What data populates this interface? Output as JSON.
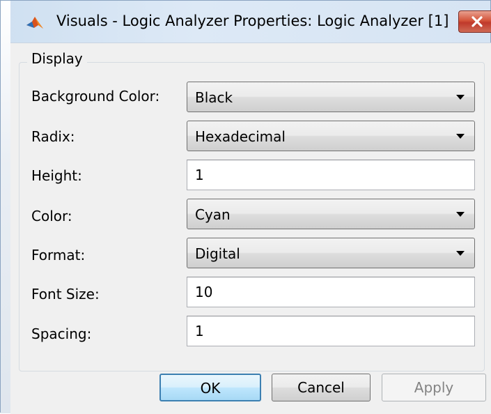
{
  "window": {
    "title": "Visuals - Logic Analyzer Properties: Logic Analyzer [1]",
    "app_icon": "matlab-icon",
    "close_icon": "close-icon",
    "close_color": "#c7402d"
  },
  "display_group": {
    "label": "Display",
    "fields": {
      "background_color": {
        "label": "Background Color:",
        "value": "Black"
      },
      "radix": {
        "label": "Radix:",
        "value": "Hexadecimal"
      },
      "height": {
        "label": "Height:",
        "value": "1"
      },
      "color": {
        "label": "Color:",
        "value": "Cyan"
      },
      "format": {
        "label": "Format:",
        "value": "Digital"
      },
      "font_size": {
        "label": "Font Size:",
        "value": "10"
      },
      "spacing": {
        "label": "Spacing:",
        "value": "1"
      }
    }
  },
  "buttons": {
    "ok": "OK",
    "cancel": "Cancel",
    "apply": "Apply",
    "apply_enabled": false
  }
}
